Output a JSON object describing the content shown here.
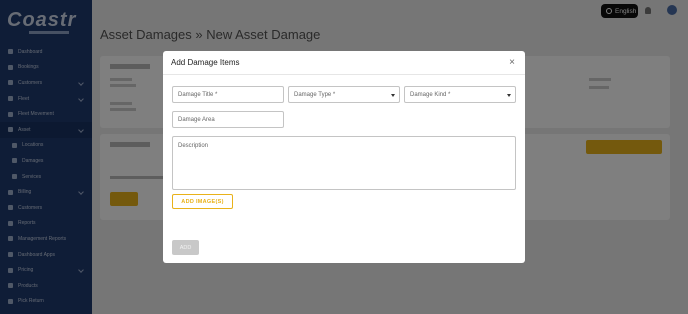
{
  "app": {
    "logo": "Coastr",
    "page_title": "Asset Damages » New Asset Damage"
  },
  "header": {
    "language": "English"
  },
  "sidebar": {
    "items": [
      {
        "label": "Dashboard",
        "icon": "dashboard-icon"
      },
      {
        "label": "Bookings",
        "icon": "bookings-icon"
      },
      {
        "label": "Customers",
        "icon": "customers-icon"
      },
      {
        "label": "Fleet",
        "icon": "fleet-icon"
      },
      {
        "label": "Fleet Movement",
        "icon": "movement-icon"
      },
      {
        "label": "Asset",
        "icon": "asset-icon"
      },
      {
        "label": "Locations",
        "icon": "locations-icon"
      },
      {
        "label": "Damages",
        "icon": "damages-icon"
      },
      {
        "label": "Services",
        "icon": "services-icon"
      },
      {
        "label": "Billing",
        "icon": "billing-icon"
      },
      {
        "label": "Customers",
        "icon": "customers-icon"
      },
      {
        "label": "Reports",
        "icon": "reports-icon"
      },
      {
        "label": "Management Reports",
        "icon": "management-reports-icon"
      },
      {
        "label": "Dashboard Apps",
        "icon": "apps-icon"
      },
      {
        "label": "Pricing",
        "icon": "pricing-icon"
      },
      {
        "label": "Products",
        "icon": "products-icon"
      },
      {
        "label": "Pick Return",
        "icon": "pick-return-icon"
      }
    ]
  },
  "modal": {
    "title": "Add Damage Items",
    "fields": {
      "damage_title": {
        "placeholder": "Damage Title *",
        "value": ""
      },
      "damage_type": {
        "placeholder": "Damage Type *",
        "value": ""
      },
      "damage_kind": {
        "placeholder": "Damage Kind *",
        "value": ""
      },
      "damage_area": {
        "placeholder": "Damage Area",
        "value": ""
      },
      "description": {
        "placeholder": "Description",
        "value": ""
      }
    },
    "add_images_label": "ADD IMAGE(S)",
    "add_label": "ADD"
  },
  "colors": {
    "sidebar": "#1f3a6e",
    "accent": "#e9b21a",
    "disabled": "#c8c8c8"
  }
}
